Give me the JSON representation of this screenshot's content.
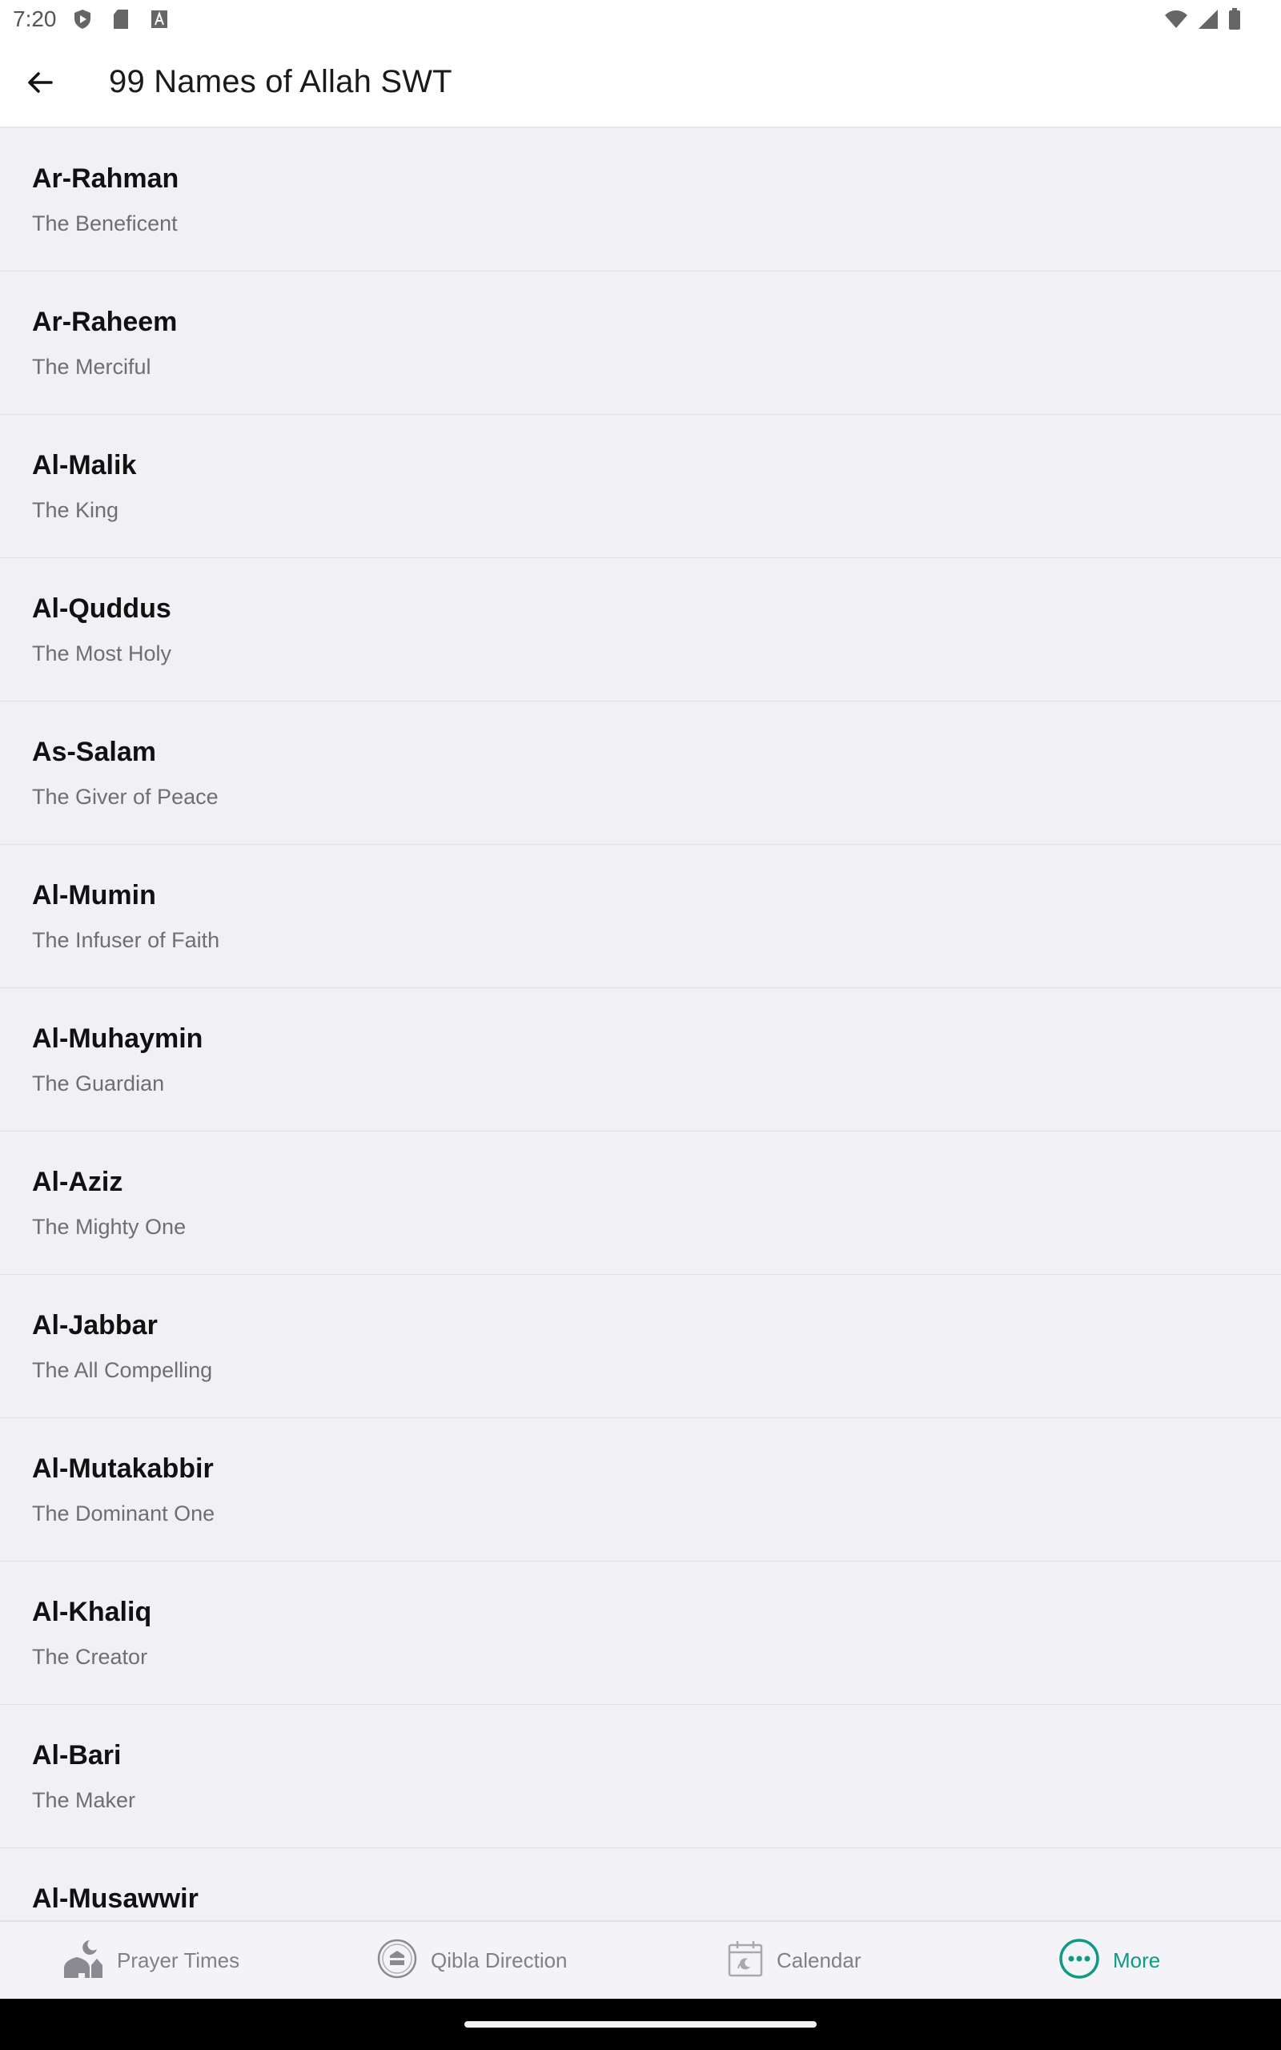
{
  "status_bar": {
    "time": "7:20",
    "left_icons": [
      "shield-play-icon",
      "sd-card-icon",
      "font-a-icon"
    ],
    "right_icons": [
      "wifi-icon",
      "signal-icon",
      "battery-icon"
    ]
  },
  "app_bar": {
    "title": "99 Names of Allah SWT",
    "back_icon": "arrow-left-icon"
  },
  "names": [
    {
      "name": "Ar-Rahman",
      "meaning": "The Beneficent"
    },
    {
      "name": "Ar-Raheem",
      "meaning": "The Merciful"
    },
    {
      "name": "Al-Malik",
      "meaning": "The King"
    },
    {
      "name": "Al-Quddus",
      "meaning": "The Most Holy"
    },
    {
      "name": "As-Salam",
      "meaning": "The Giver of Peace"
    },
    {
      "name": "Al-Mumin",
      "meaning": "The Infuser of Faith"
    },
    {
      "name": "Al-Muhaymin",
      "meaning": "The Guardian"
    },
    {
      "name": "Al-Aziz",
      "meaning": "The Mighty One"
    },
    {
      "name": "Al-Jabbar",
      "meaning": "The All Compelling"
    },
    {
      "name": "Al-Mutakabbir",
      "meaning": "The Dominant One"
    },
    {
      "name": "Al-Khaliq",
      "meaning": "The Creator"
    },
    {
      "name": "Al-Bari",
      "meaning": "The Maker"
    },
    {
      "name": "Al-Musawwir",
      "meaning": ""
    }
  ],
  "bottom_nav": {
    "items": [
      {
        "label": "Prayer Times",
        "icon": "mosque-moon-icon",
        "active": false
      },
      {
        "label": "Qibla Direction",
        "icon": "kaaba-compass-icon",
        "active": false
      },
      {
        "label": "Calendar",
        "icon": "calendar-icon",
        "active": false
      },
      {
        "label": "More",
        "icon": "more-dots-icon",
        "active": true
      }
    ]
  },
  "colors": {
    "accent": "#0f9a84",
    "list_background": "#f0f0f5",
    "app_bar_background": "#ffffff",
    "inactive_nav": "#808086"
  }
}
